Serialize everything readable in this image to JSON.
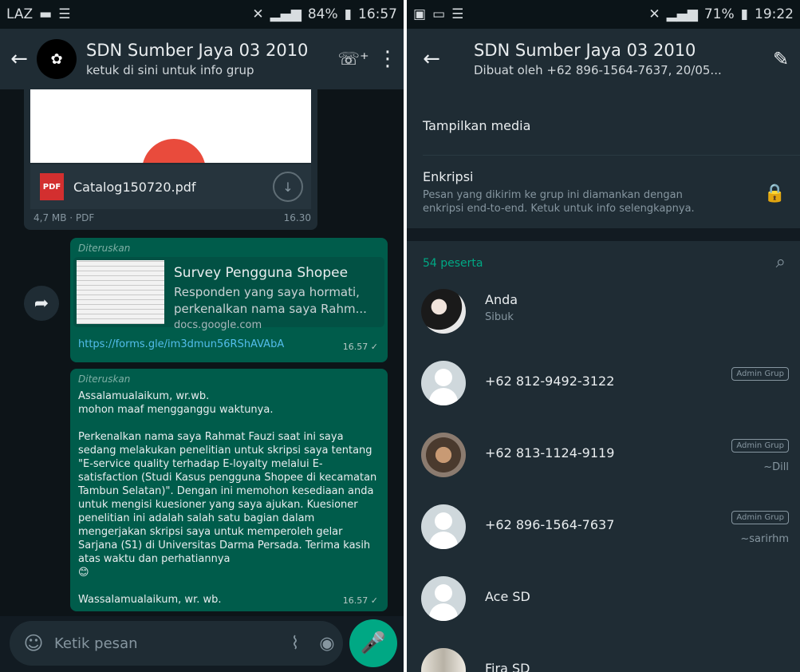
{
  "left": {
    "status": {
      "carrier": "LAZ",
      "battery": "84%",
      "time": "16:57"
    },
    "header": {
      "title": "SDN Sumber Jaya 03 2010",
      "subtitle": "ketuk di sini untuk info grup"
    },
    "file_message": {
      "name": "Catalog150720.pdf",
      "size": "4,7 MB · PDF",
      "time": "16.30",
      "type_label": "PDF"
    },
    "link_message": {
      "forwarded_label": "Diteruskan",
      "card_title": "Survey Pengguna Shopee",
      "card_description": "Responden yang saya hormati, perkenalkan nama saya Rahm...",
      "card_host": "docs.google.com",
      "url": "https://forms.gle/im3dmun56RShAVAbA",
      "time": "16.57 ✓"
    },
    "text_message": {
      "forwarded_label": "Diteruskan",
      "body": "Assalamualaikum, wr.wb.\nmohon maaf mengganggu waktunya.\n\nPerkenalkan nama saya Rahmat Fauzi saat ini saya sedang melakukan penelitian untuk skripsi saya tentang \"E-service quality terhadap E-loyalty melalui E-satisfaction (Studi Kasus pengguna Shopee di kecamatan Tambun Selatan)\". Dengan ini memohon kesediaan anda untuk mengisi kuesioner yang saya ajukan. Kuesioner penelitian ini adalah salah satu bagian dalam mengerjakan skripsi saya untuk memperoleh gelar Sarjana (S1) di Universitas Darma Persada. Terima kasih atas waktu dan perhatiannya\n😊",
      "closing": "Wassalamualaikum, wr. wb.",
      "time": "16.57 ✓"
    },
    "composer": {
      "placeholder": "Ketik pesan"
    }
  },
  "right": {
    "status": {
      "battery": "71%",
      "time": "19:22"
    },
    "header": {
      "title": "SDN Sumber Jaya 03 2010",
      "subtitle": "Dibuat oleh +62 896-1564-7637, 20/05..."
    },
    "media_label": "Tampilkan media",
    "encryption": {
      "title": "Enkripsi",
      "description": "Pesan yang dikirim ke grup ini diamankan dengan enkripsi end-to-end. Ketuk untuk info selengkapnya."
    },
    "participants_count": "54 peserta",
    "members": [
      {
        "name": "Anda",
        "status": "Sibuk",
        "badge": "",
        "alias": ""
      },
      {
        "name": "+62 812-9492-3122",
        "status": "",
        "badge": "Admin Grup",
        "alias": ""
      },
      {
        "name": "+62 813-1124-9119",
        "status": "",
        "badge": "Admin Grup",
        "alias": "~Dill"
      },
      {
        "name": "+62 896-1564-7637",
        "status": "",
        "badge": "Admin Grup",
        "alias": "~sarirhm"
      },
      {
        "name": "Ace SD",
        "status": "",
        "badge": "",
        "alias": ""
      },
      {
        "name": "Fira SD",
        "status": "",
        "badge": "",
        "alias": ""
      }
    ]
  },
  "icons": {
    "back": "arrow-left-icon",
    "call": "add-call-icon",
    "menu": "more-vert-icon",
    "edit": "pencil-icon",
    "search": "search-icon",
    "lock": "lock-icon",
    "emoji": "emoji-icon",
    "attach": "paperclip-icon",
    "camera": "camera-icon",
    "mic": "mic-icon",
    "forward": "forward-icon",
    "download": "download-icon"
  },
  "colors": {
    "accent": "#00a884",
    "outgoing_bubble": "#005c4b",
    "header": "#1f2c34",
    "link": "#53bdeb"
  }
}
